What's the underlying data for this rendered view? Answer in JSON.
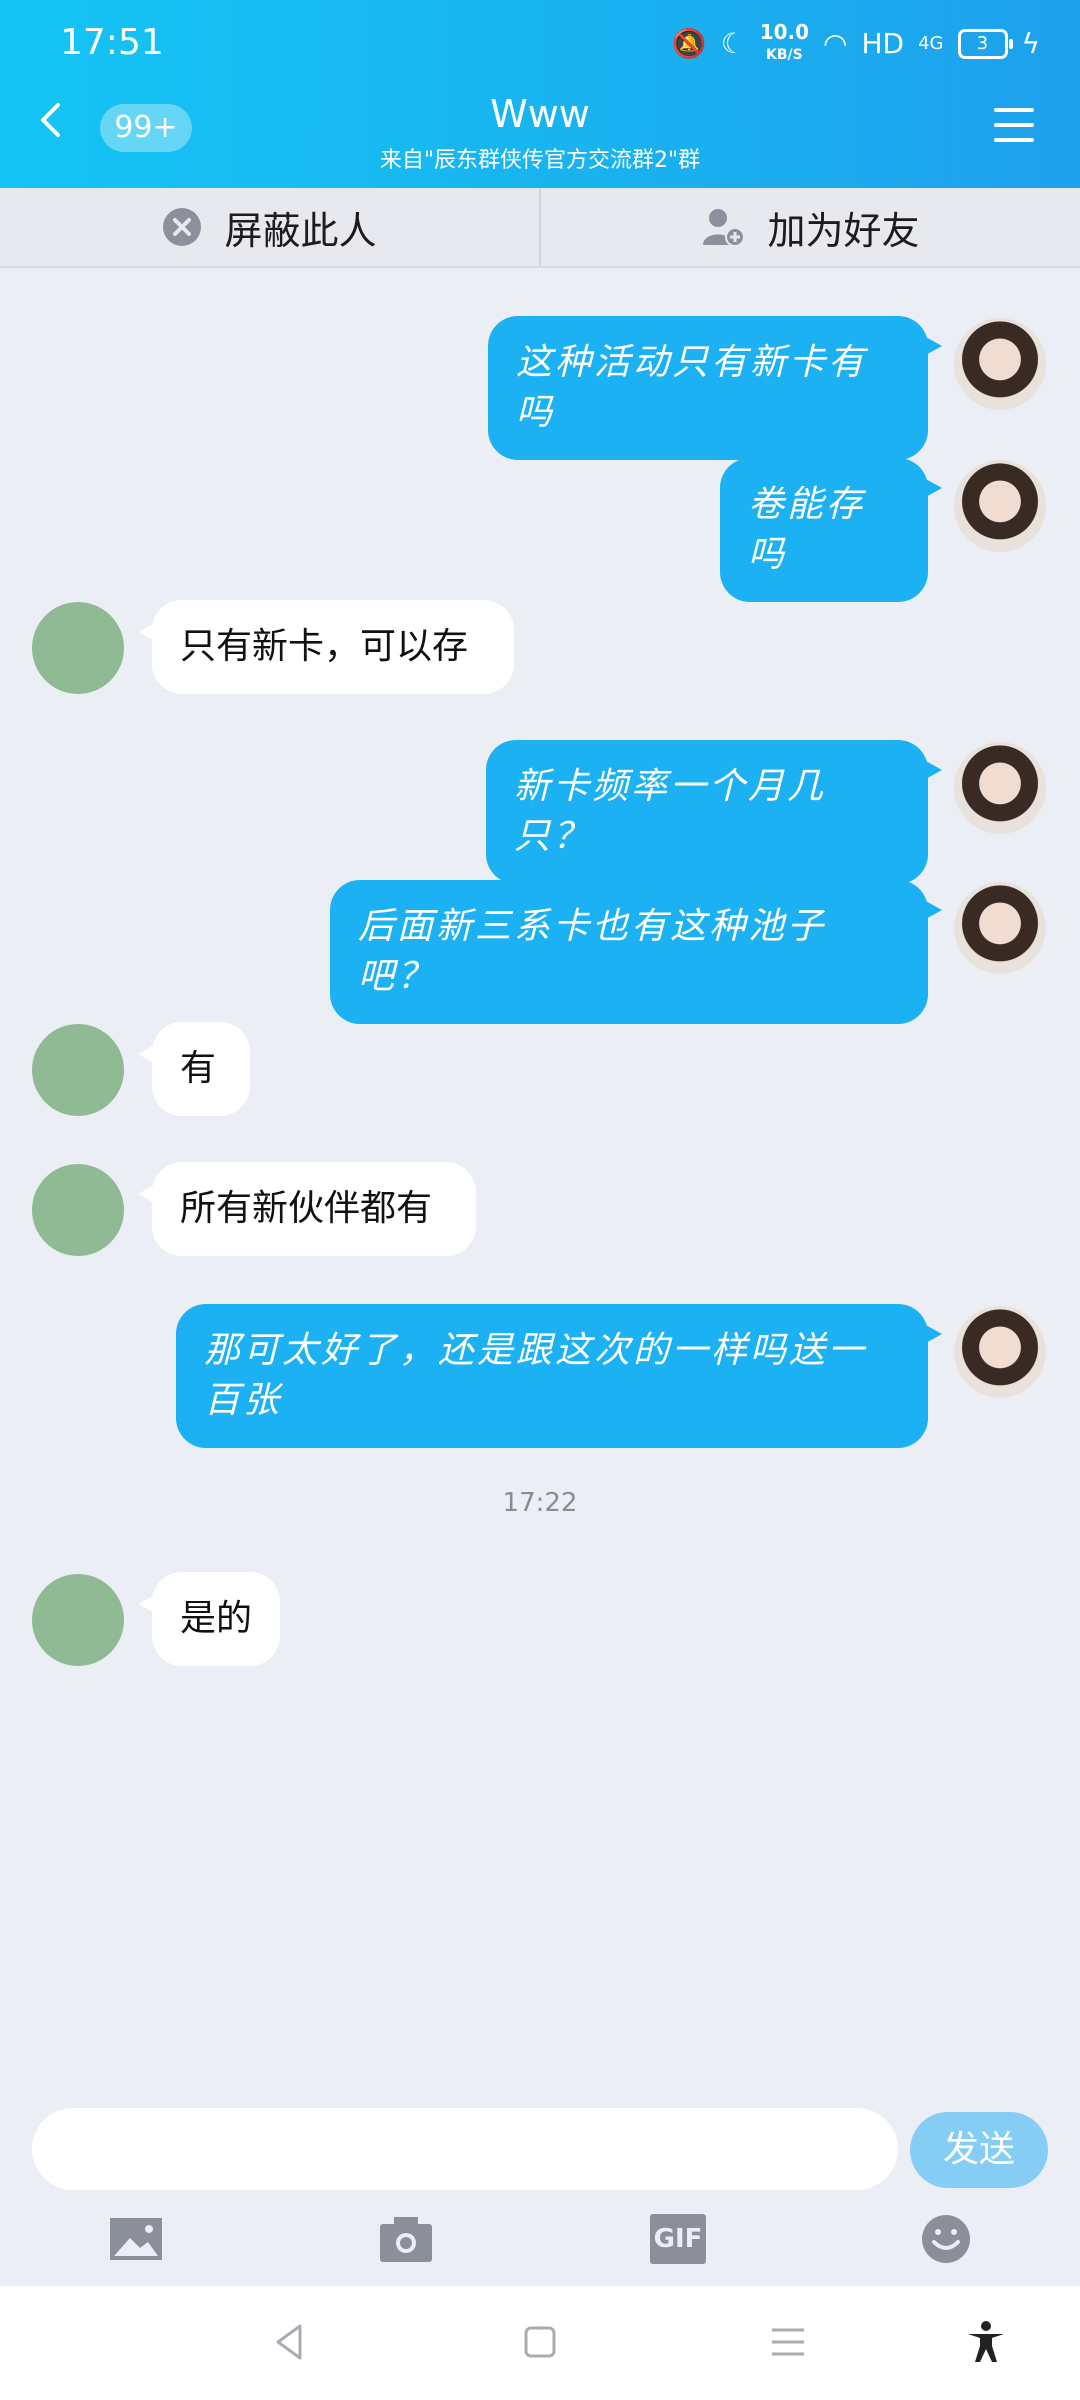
{
  "status": {
    "time": "17:51",
    "speed_value": "10.0",
    "speed_unit": "KB/S",
    "hd": "HD",
    "net": "4G",
    "battery": "3"
  },
  "header": {
    "unread": "99+",
    "title": "Www",
    "subtitle": "来自\"辰东群侠传官方交流群2\"群"
  },
  "actions": {
    "block": "屏蔽此人",
    "add_friend": "加为好友"
  },
  "messages": [
    {
      "from": "me",
      "text": "这种活动只有新卡有吗"
    },
    {
      "from": "me",
      "text": "卷能存吗"
    },
    {
      "from": "other",
      "text": "只有新卡，可以存"
    },
    {
      "from": "me",
      "text": "新卡频率一个月几只？"
    },
    {
      "from": "me",
      "text": "后面新三系卡也有这种池子吧？"
    },
    {
      "from": "other",
      "text": "有"
    },
    {
      "from": "other",
      "text": "所有新伙伴都有"
    },
    {
      "from": "me",
      "text": "那可太好了，还是跟这次的一样吗送一百张"
    },
    {
      "from": "other",
      "text": "是的"
    }
  ],
  "timestamp": "17:22",
  "input": {
    "placeholder": "",
    "send": "发送"
  },
  "tools": {
    "gif": "GIF"
  },
  "colors": {
    "header": "#19b3f0",
    "my_bubble": "#1cb1f2",
    "send_button": "#86cdf5",
    "background": "#eceef5"
  }
}
